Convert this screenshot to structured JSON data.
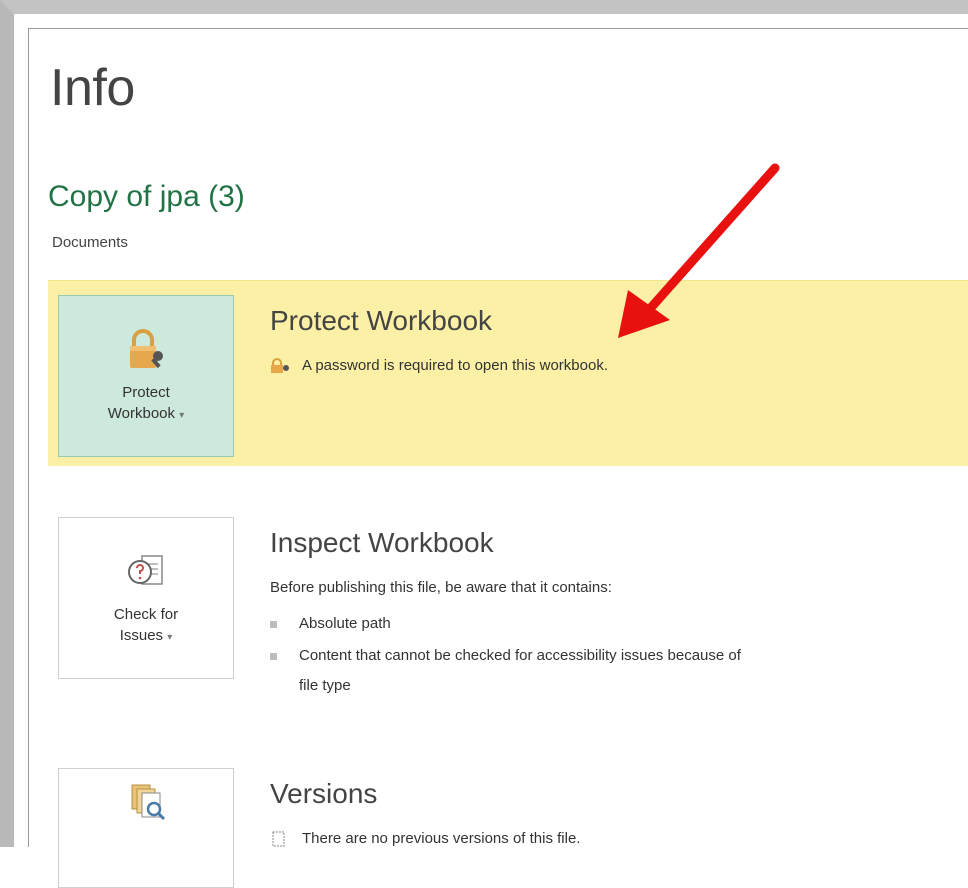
{
  "page": {
    "title": "Info"
  },
  "document": {
    "name": "Copy of jpa (3)",
    "location": "Documents"
  },
  "protect": {
    "button_label_line1": "Protect",
    "button_label_line2": "Workbook",
    "button_dropdown": "▾",
    "heading": "Protect Workbook",
    "status_text": "A password is required to open this workbook.",
    "highlight_color": "#fbf0a6"
  },
  "inspect": {
    "button_label_line1": "Check for",
    "button_label_line2": "Issues",
    "button_dropdown": "▾",
    "heading": "Inspect Workbook",
    "intro": "Before publishing this file, be aware that it contains:",
    "items": [
      "Absolute path",
      "Content that cannot be checked for accessibility issues because of",
      "file type"
    ]
  },
  "versions": {
    "heading": "Versions",
    "status_text": "There are no previous versions of this file."
  },
  "annotation": {
    "arrow_color": "#e8110f"
  }
}
